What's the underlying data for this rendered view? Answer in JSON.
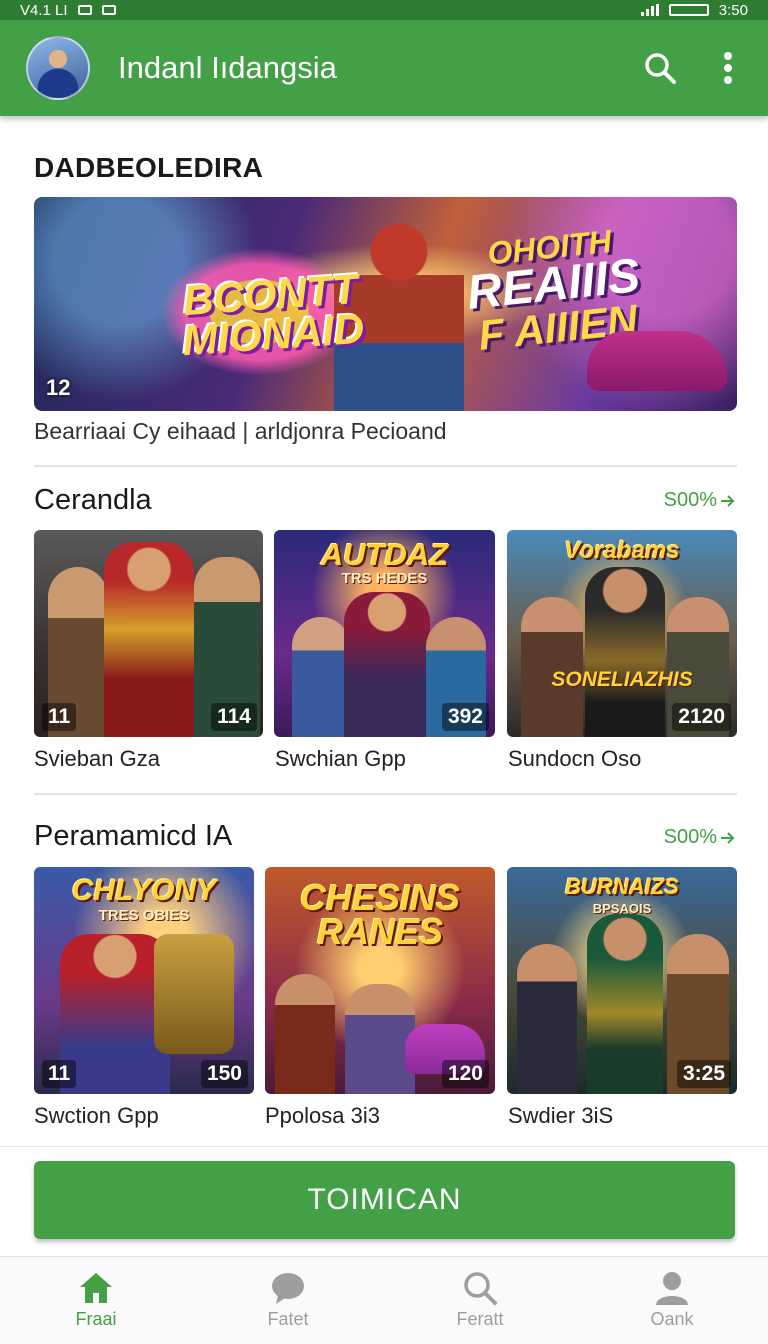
{
  "status_bar": {
    "left_text": "V4.1 LI",
    "right_text": "3:50"
  },
  "app_bar": {
    "title": "Indanl Iıdangsia"
  },
  "featured": {
    "heading": "DADBEOLEDIRA",
    "banner": {
      "logo_text": "BCONTT MIONAID",
      "tagline_line1": "OHOITH",
      "tagline_line2": "REAIIIS",
      "tagline_line3": "F AIIIEN",
      "badge": "12"
    },
    "caption": "Bearriaai Cy eihaad | arldjonra Pecioand"
  },
  "sections": [
    {
      "title": "Cerandla",
      "see_all": "S00%",
      "cards": [
        {
          "label": "Svieban Gza",
          "count_left": "11",
          "count_right": "114"
        },
        {
          "label": "Swchian Gpp",
          "art_title": "AUTDAZ",
          "art_subtitle": "TRS HEDES",
          "count_right": "392"
        },
        {
          "label": "Sundocn Oso",
          "art_title": "Vorabams",
          "art_subtitle": "SONELIAZHIS",
          "count_right": "2120"
        }
      ]
    },
    {
      "title": "Peramamicd IA",
      "see_all": "S00%",
      "cards": [
        {
          "label": "Swction Gpp",
          "art_title": "CHLYONY",
          "art_subtitle": "TRES OBIES",
          "count_left": "11",
          "count_right": "150"
        },
        {
          "label": "Ppolosa 3i3",
          "art_title": "CHESINS RANES",
          "count_right": "120"
        },
        {
          "label": "Swdier 3iS",
          "art_title": "BURNAIZS",
          "art_subtitle": "BPSAOIS",
          "count_right": "3:25"
        }
      ]
    }
  ],
  "primary_button": {
    "label": "TOIMICAN"
  },
  "bottom_nav": [
    {
      "label": "Fraai",
      "icon": "home-icon",
      "active": true
    },
    {
      "label": "Fatet",
      "icon": "chat-icon",
      "active": false
    },
    {
      "label": "Feratt",
      "icon": "search-icon",
      "active": false
    },
    {
      "label": "Oank",
      "icon": "person-icon",
      "active": false
    }
  ],
  "colors": {
    "primary": "#43a047",
    "status_bar": "#2e7d32",
    "nav_inactive": "#9e9e9e"
  }
}
